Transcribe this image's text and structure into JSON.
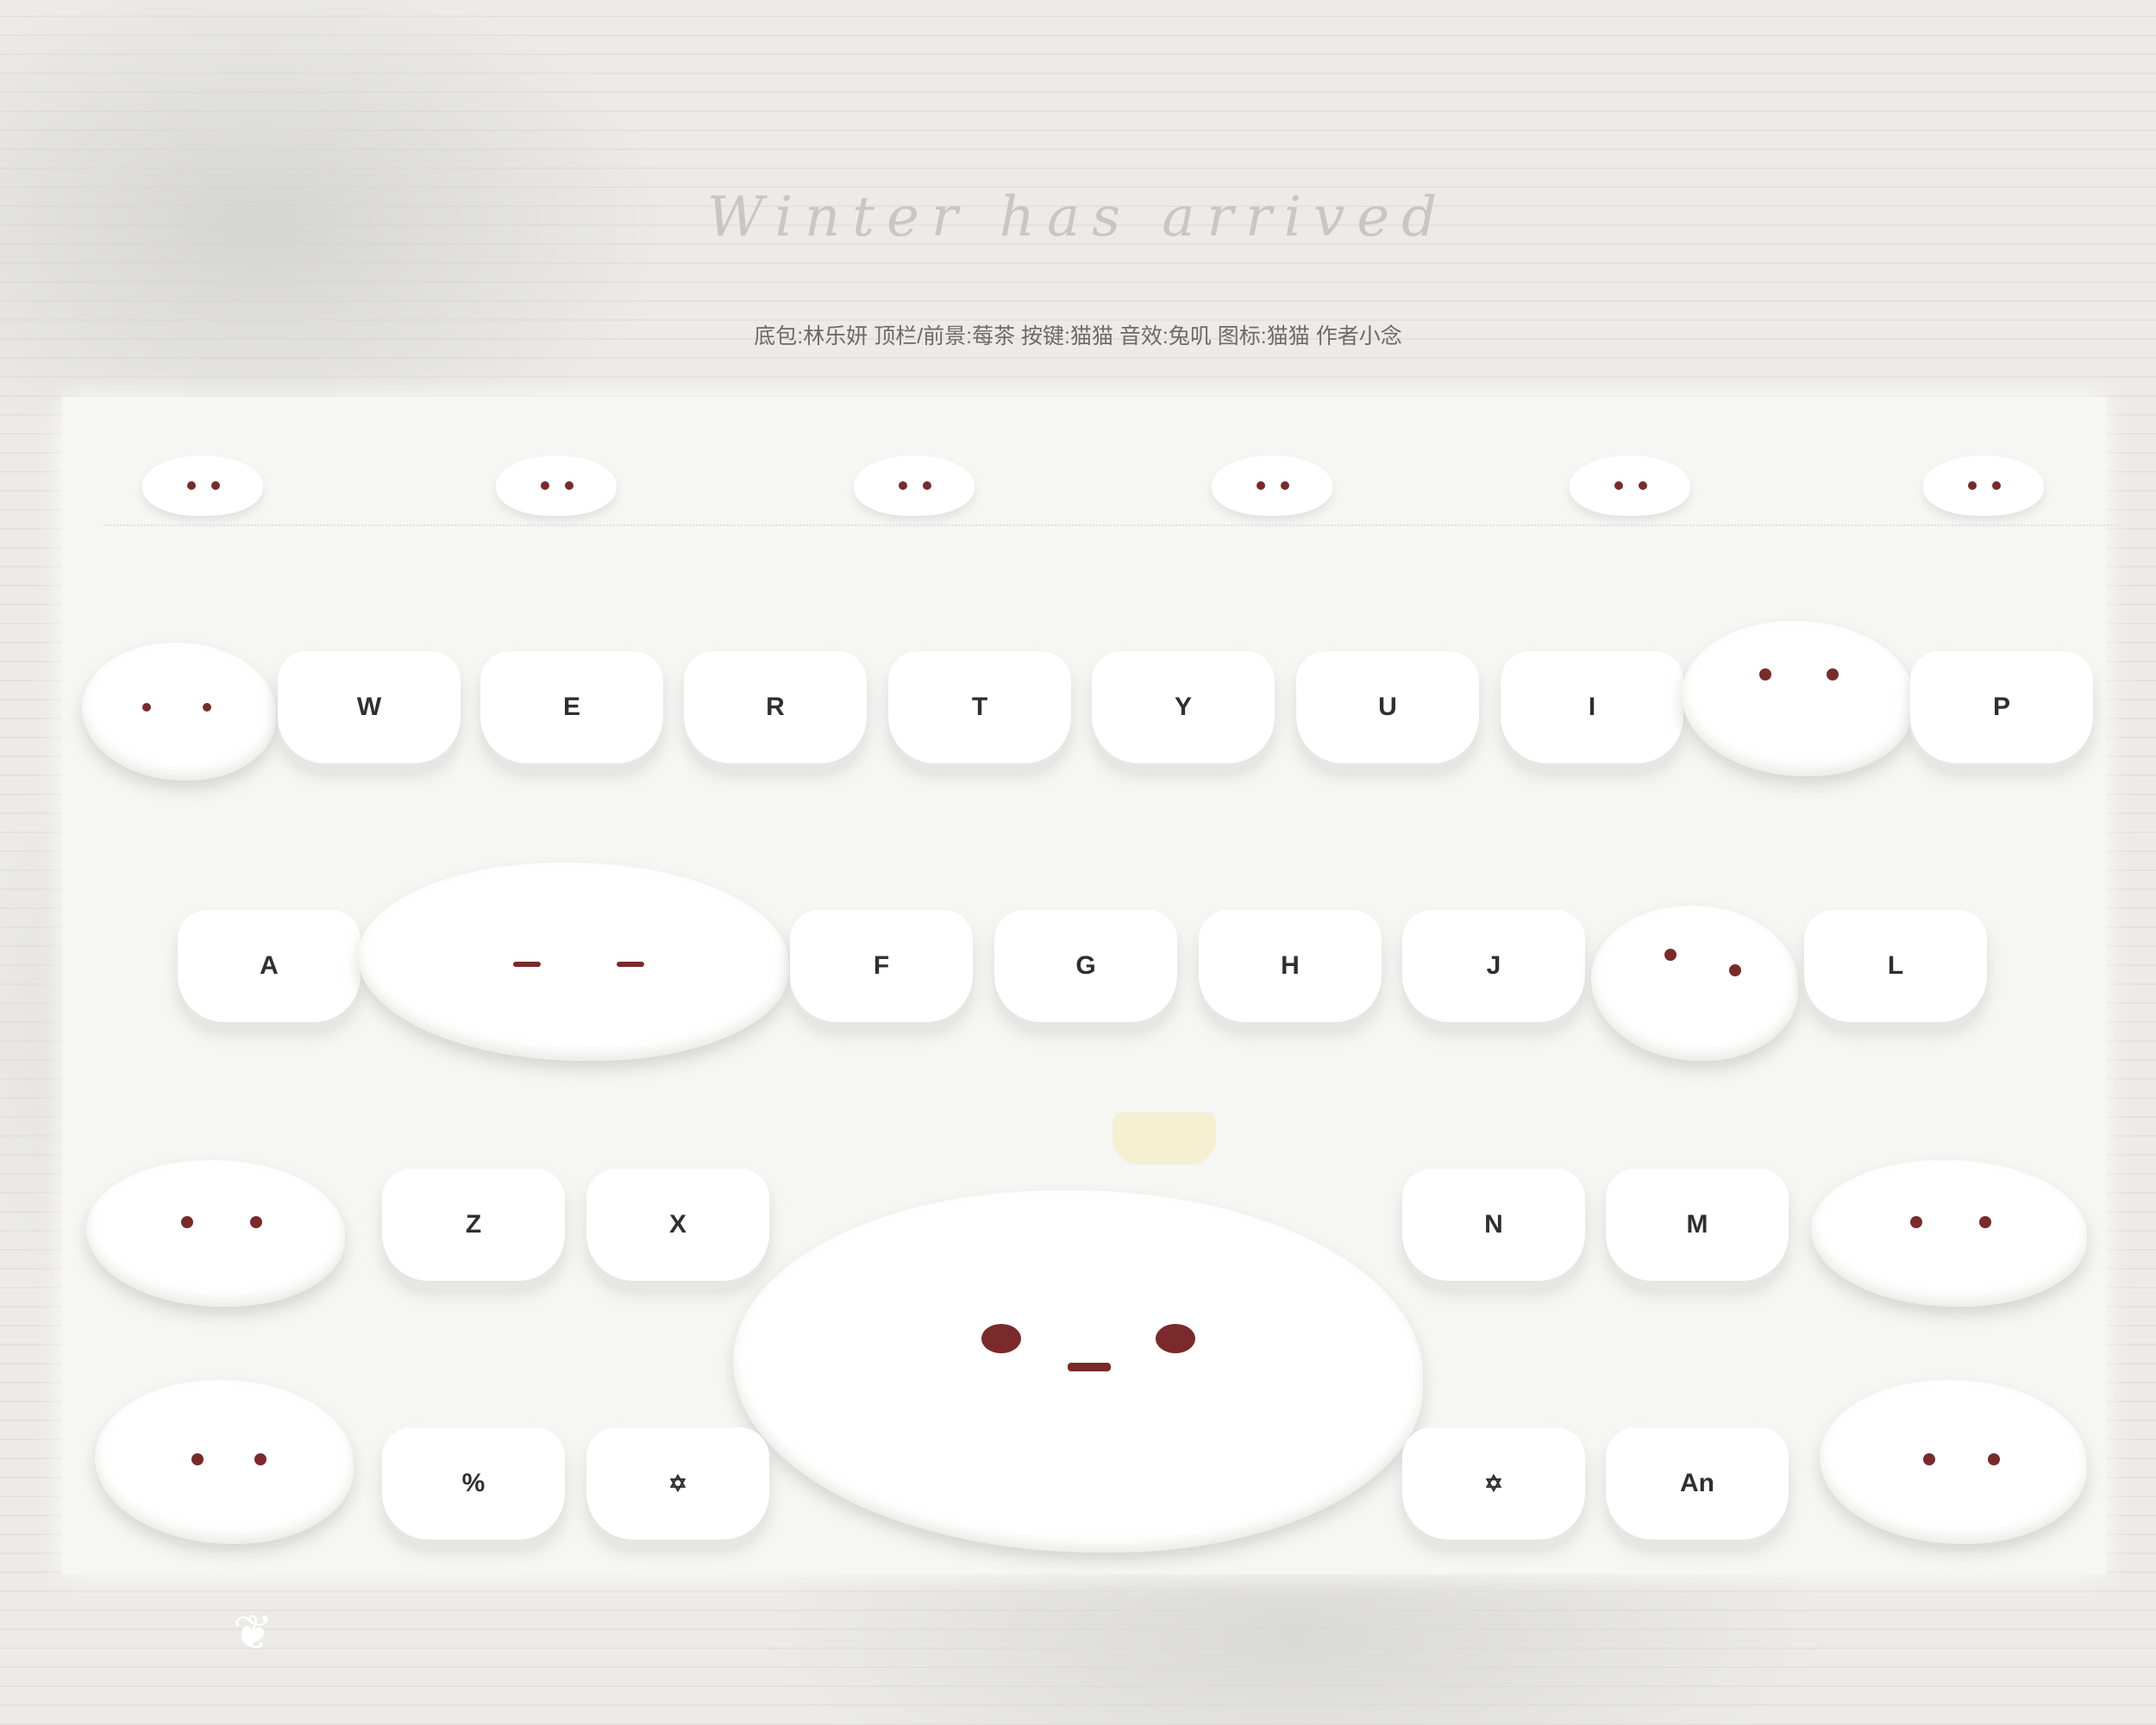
{
  "header": {
    "title": "Winter has arrived",
    "credits": "底包:林乐妍 顶栏/前景:莓茶 按键:猫猫 音效:兔叽 图标:猫猫 作者小念"
  },
  "keyboard": {
    "row1": [
      "W",
      "E",
      "R",
      "T",
      "Y",
      "U",
      "I",
      "P"
    ],
    "row2": [
      "A",
      "F",
      "G",
      "H",
      "J",
      "L"
    ],
    "row3": [
      "Z",
      "X",
      "N",
      "M"
    ],
    "row4": [
      "%",
      "✡",
      "✡",
      "An"
    ]
  },
  "colors": {
    "background": "#ecebea",
    "key": "#ffffff",
    "key_text": "#2f2f2f",
    "eye": "#7a2a2a"
  },
  "icons": [
    "cloud-mascot-icon",
    "crown-icon",
    "butterfly-icon"
  ]
}
